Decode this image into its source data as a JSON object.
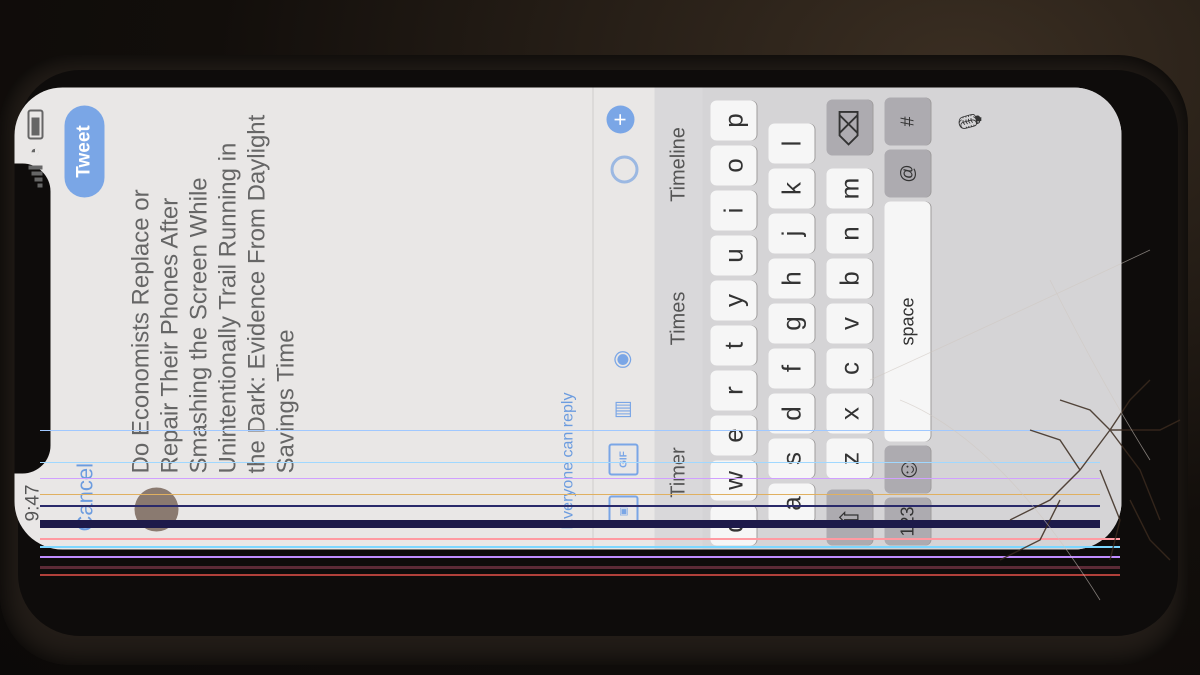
{
  "status_bar": {
    "time": "9:47"
  },
  "header": {
    "cancel_label": "Cancel",
    "tweet_label": "Tweet"
  },
  "compose": {
    "text": "Do Economists Replace or Repair Their Phones After Smashing the Screen While Unintentionally Trail Running in the Dark: Evidence From Daylight Savings Time"
  },
  "reply_setting": "Everyone can reply",
  "toolbar": {
    "icons": [
      "image-icon",
      "gif-icon",
      "poll-icon",
      "location-icon",
      "progress-ring-icon",
      "add-thread-icon"
    ],
    "gif_label": "GIF",
    "add_symbol": "+"
  },
  "keyboard": {
    "suggestions": [
      "Timer",
      "Times",
      "Timeline"
    ],
    "row1": [
      "q",
      "w",
      "e",
      "r",
      "t",
      "y",
      "u",
      "i",
      "o",
      "p"
    ],
    "row2": [
      "a",
      "s",
      "d",
      "f",
      "g",
      "h",
      "j",
      "k",
      "l"
    ],
    "row3": [
      "z",
      "x",
      "c",
      "v",
      "b",
      "n",
      "m"
    ],
    "shift_symbol": "⇧",
    "delete_symbol": "⌫",
    "numbers_label": "123",
    "emoji_symbol": "☺",
    "space_label": "space",
    "at_label": "@",
    "hash_label": "#",
    "mic_symbol": "🎙"
  },
  "colors": {
    "accent": "#7aa6e6",
    "link": "#6c9cdf",
    "screen_bg": "#e9e7e6"
  }
}
